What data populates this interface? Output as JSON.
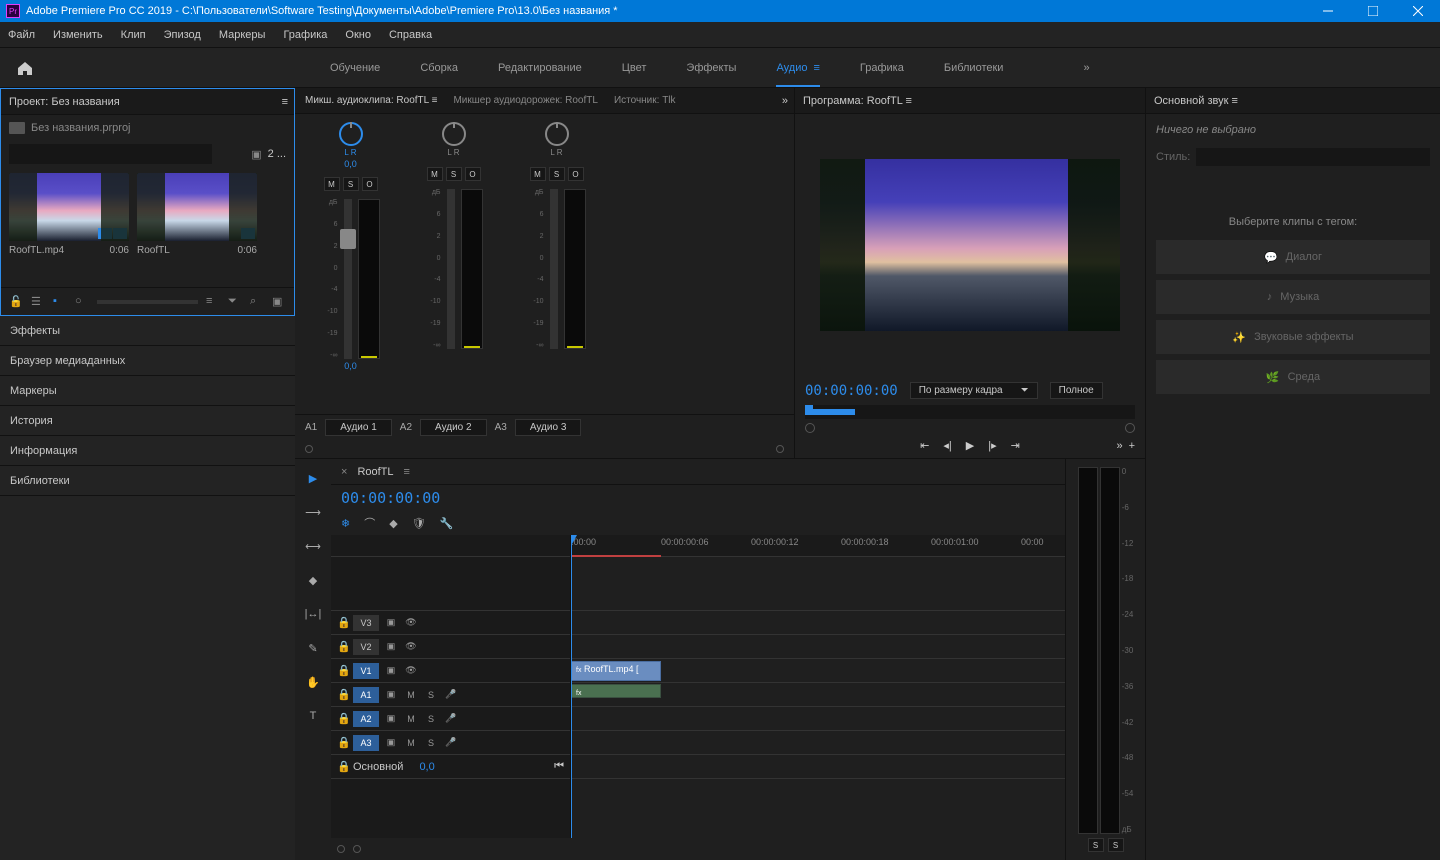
{
  "title_bar": {
    "app_icon_text": "Pr",
    "title": "Adobe Premiere Pro CC 2019 - C:\\Пользователи\\Software Testing\\Документы\\Adobe\\Premiere Pro\\13.0\\Без названия *"
  },
  "menu": {
    "file": "Файл",
    "edit": "Изменить",
    "clip": "Клип",
    "sequence": "Эпизод",
    "markers": "Маркеры",
    "graphics": "Графика",
    "window": "Окно",
    "help": "Справка"
  },
  "workspaces": {
    "learn": "Обучение",
    "assembly": "Сборка",
    "editing": "Редактирование",
    "color": "Цвет",
    "effects": "Эффекты",
    "audio": "Аудио",
    "graphics": "Графика",
    "libraries": "Библиотеки"
  },
  "project_panel": {
    "title": "Проект: Без названия",
    "file": "Без названия.prproj",
    "count": "2 ...",
    "bins": [
      {
        "name": "RoofTL.mp4",
        "dur": "0:06"
      },
      {
        "name": "RoofTL",
        "dur": "0:06"
      }
    ]
  },
  "stack_panels": {
    "effects": "Эффекты",
    "media_browser": "Браузер медиаданных",
    "markers": "Маркеры",
    "history": "История",
    "info": "Информация",
    "libraries": "Библиотеки"
  },
  "mixer": {
    "tab_clip": "Микш. аудиоклипа: RoofTL",
    "tab_track": "Микшер аудиодорожек: RoofTL",
    "tab_source": "Источник: Tlk",
    "lr_active": "L       R",
    "lr": "L       R",
    "val_active": "0,0",
    "val_dim": "",
    "m": "M",
    "s": "S",
    "o": "O",
    "db_label": "дБ",
    "db_marks": [
      "6",
      "2",
      "0",
      "-4",
      "-10",
      "-19",
      "-∞"
    ],
    "strip_val": "0,0",
    "footer": [
      {
        "id": "A1",
        "label": "Аудио 1"
      },
      {
        "id": "A2",
        "label": "Аудио 2"
      },
      {
        "id": "A3",
        "label": "Аудио 3"
      }
    ]
  },
  "program": {
    "title": "Программа: RoofTL",
    "timecode": "00:00:00:00",
    "fit": "По размеру кадра",
    "full": "Полное"
  },
  "essential_sound": {
    "title": "Основной звук",
    "none_selected": "Ничего не выбрано",
    "style_label": "Стиль:",
    "prompt": "Выберите клипы с тегом:",
    "btn_dialog": "Диалог",
    "btn_music": "Музыка",
    "btn_sfx": "Звуковые эффекты",
    "btn_ambience": "Среда"
  },
  "timeline": {
    "seq_name": "RoofTL",
    "timecode": "00:00:00:00",
    "ruler": [
      ":00:00",
      "00:00:00:06",
      "00:00:00:12",
      "00:00:00:18",
      "00:00:01:00",
      "00:00"
    ],
    "tracks": {
      "v3": "V3",
      "v2": "V2",
      "v1": "V1",
      "a1": "A1",
      "a2": "A2",
      "a3": "A3",
      "main": "Основной",
      "main_val": "0,0",
      "m": "M",
      "s": "S"
    },
    "clip_name": "RoofTL.mp4 ["
  },
  "big_meter": {
    "db_marks": [
      "0",
      "-6",
      "-12",
      "-18",
      "-24",
      "-30",
      "-36",
      "-42",
      "-48",
      "-54",
      "дБ"
    ],
    "s": "S"
  }
}
